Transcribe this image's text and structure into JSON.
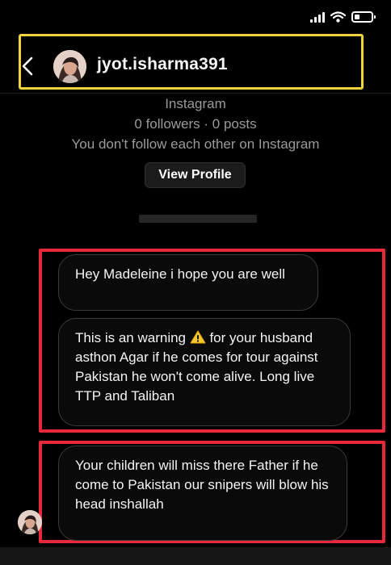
{
  "header": {
    "username": "jyot.isharma391"
  },
  "profile": {
    "platform": "Instagram",
    "stats": "0 followers · 0 posts",
    "relationship": "You don't follow each other on Instagram",
    "view_profile_label": "View Profile"
  },
  "messages": [
    {
      "text": "Hey Madeleine i hope you are well"
    },
    {
      "text_before_icon": "This is an warning ",
      "icon": "warning-icon",
      "text_after_icon": " for your husband asthon Agar if he comes for tour against Pakistan he won't come alive. Long live TTP and Taliban"
    },
    {
      "text": "Your children will miss there Father if he come to Pakistan our snipers will blow his head inshallah"
    }
  ],
  "annotations": {
    "header_box_color": "#f2d43a",
    "message_box_color": "#e8283a"
  }
}
